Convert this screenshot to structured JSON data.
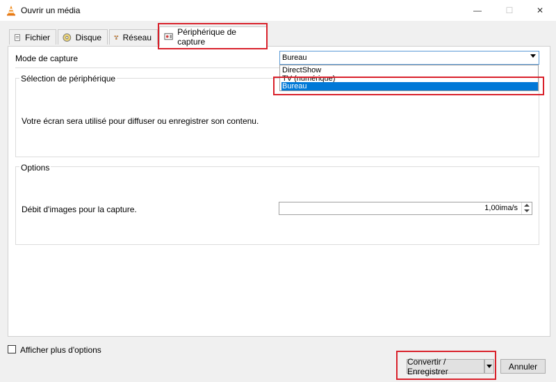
{
  "window": {
    "title": "Ouvrir un média",
    "controls": {
      "minimize": "—",
      "maximize": "☐",
      "close": "✕"
    }
  },
  "tabs": [
    {
      "label": "Fichier",
      "icon": "file-icon"
    },
    {
      "label": "Disque",
      "icon": "disc-icon"
    },
    {
      "label": "Réseau",
      "icon": "network-icon"
    },
    {
      "label": "Périphérique de capture",
      "icon": "capture-device-icon",
      "active": true
    }
  ],
  "capture": {
    "mode_label": "Mode de capture",
    "selected": "Bureau",
    "options": [
      "DirectShow",
      "TV (numérique)",
      "Bureau"
    ]
  },
  "device_selection": {
    "title": "Sélection de périphérique",
    "description": "Votre écran sera utilisé pour diffuser ou enregistrer son contenu."
  },
  "options": {
    "title": "Options",
    "frame_rate_label": "Débit d'images pour la capture.",
    "frame_rate_value": "1,00ima/s"
  },
  "footer": {
    "more_options_label": "Afficher plus d'options",
    "convert_label": "Convertir / Enregistrer",
    "cancel_label": "Annuler"
  },
  "colors": {
    "accent": "#0078d7",
    "highlight": "#d9202a"
  }
}
